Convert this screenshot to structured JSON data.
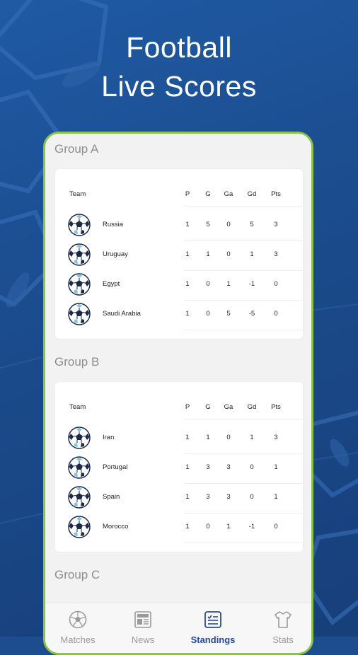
{
  "headline": {
    "line1": "Football",
    "line2": "Live Scores"
  },
  "columns": {
    "team": "Team",
    "p": "P",
    "g": "G",
    "ga": "Ga",
    "gd": "Gd",
    "pts": "Pts"
  },
  "groups": [
    {
      "title": "Group A",
      "rows": [
        {
          "team": "Russia",
          "p": "1",
          "g": "5",
          "ga": "0",
          "gd": "5",
          "pts": "3"
        },
        {
          "team": "Uruguay",
          "p": "1",
          "g": "1",
          "ga": "0",
          "gd": "1",
          "pts": "3"
        },
        {
          "team": "Egypt",
          "p": "1",
          "g": "0",
          "ga": "1",
          "gd": "-1",
          "pts": "0"
        },
        {
          "team": "Saudi Arabia",
          "p": "1",
          "g": "0",
          "ga": "5",
          "gd": "-5",
          "pts": "0"
        }
      ]
    },
    {
      "title": "Group B",
      "rows": [
        {
          "team": "Iran",
          "p": "1",
          "g": "1",
          "ga": "0",
          "gd": "1",
          "pts": "3"
        },
        {
          "team": "Portugal",
          "p": "1",
          "g": "3",
          "ga": "3",
          "gd": "0",
          "pts": "1"
        },
        {
          "team": "Spain",
          "p": "1",
          "g": "3",
          "ga": "3",
          "gd": "0",
          "pts": "1"
        },
        {
          "team": "Morocco",
          "p": "1",
          "g": "0",
          "ga": "1",
          "gd": "-1",
          "pts": "0"
        }
      ]
    },
    {
      "title": "Group C"
    }
  ],
  "tabs": [
    {
      "label": "Matches",
      "icon": "soccer-ball-icon",
      "active": false
    },
    {
      "label": "News",
      "icon": "newspaper-icon",
      "active": false
    },
    {
      "label": "Standings",
      "icon": "standings-list-icon",
      "active": true
    },
    {
      "label": "Stats",
      "icon": "jersey-icon",
      "active": false
    }
  ],
  "colors": {
    "frame_accent": "#8bc34a",
    "active_tab": "#2a4b9b",
    "background": "#1d4d8f"
  }
}
